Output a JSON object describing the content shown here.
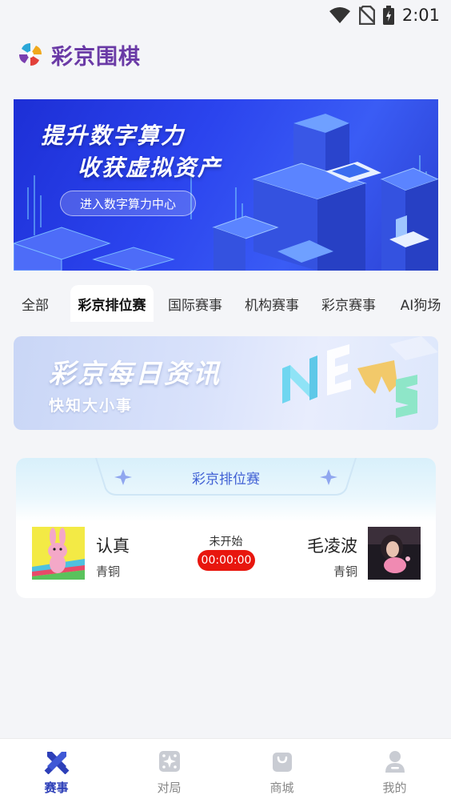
{
  "status_bar": {
    "time": "2:01"
  },
  "header": {
    "title": "彩京围棋"
  },
  "banner": {
    "line1": "提升数字算力",
    "line2": "收获虚拟资产",
    "button_label": "进入数字算力中心"
  },
  "tabs": [
    {
      "label": "全部"
    },
    {
      "label": "彩京排位赛"
    },
    {
      "label": "国际赛事"
    },
    {
      "label": "机构赛事"
    },
    {
      "label": "彩京赛事"
    },
    {
      "label": "AI狗场"
    }
  ],
  "news": {
    "title": "彩京每日资讯",
    "subtitle": "快知大小事"
  },
  "match": {
    "title": "彩京排位赛",
    "status": "未开始",
    "timer": "00:00:00",
    "player1": {
      "name": "认真",
      "rank": "青铜"
    },
    "player2": {
      "name": "毛凌波",
      "rank": "青铜"
    }
  },
  "bottom_nav": [
    {
      "label": "赛事"
    },
    {
      "label": "对局"
    },
    {
      "label": "商城"
    },
    {
      "label": "我的"
    }
  ],
  "colors": {
    "accent": "#2d3fb8",
    "timer_red": "#e8160e",
    "brand_purple": "#6a3aa6"
  }
}
